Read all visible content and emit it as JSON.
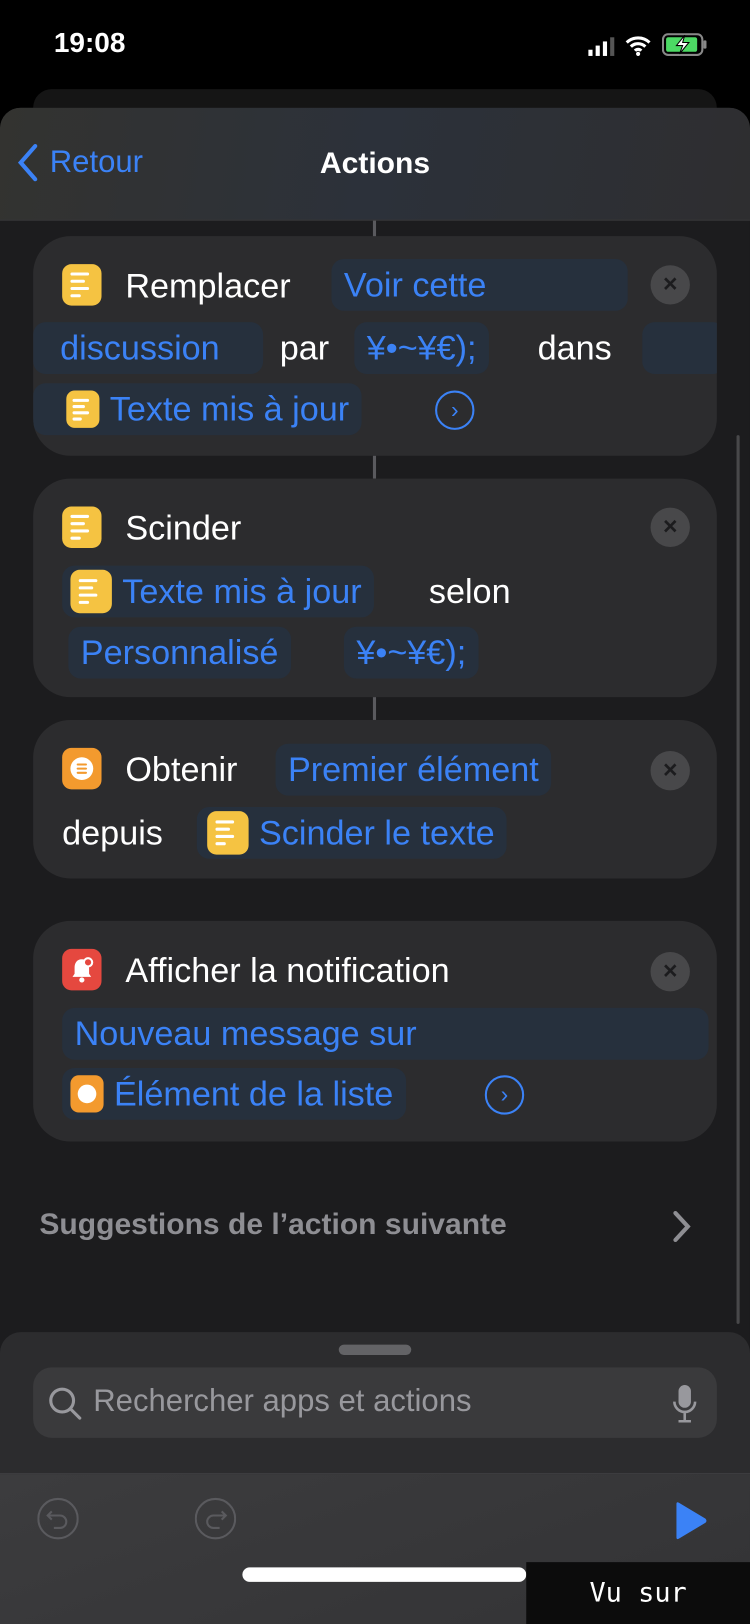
{
  "status_bar": {
    "time": "19:08",
    "signal": "cellular-icon",
    "wifi": "wifi-icon",
    "battery": "battery-charging-icon"
  },
  "nav": {
    "back_label": "Retour",
    "title": "Actions"
  },
  "actions": [
    {
      "verb": "Remplacer",
      "find_line1": "Voir cette",
      "find_line2": "discussion",
      "by": "par",
      "replacement": "¥•~¥€);",
      "in": "dans",
      "input": "Texte mis à jour"
    },
    {
      "verb": "Scinder",
      "input": "Texte mis à jour",
      "by": "selon",
      "separator_type": "Personnalisé",
      "separator": "¥•~¥€);"
    },
    {
      "verb": "Obtenir",
      "item": "Premier élément",
      "from": "depuis",
      "input": "Scinder le texte"
    },
    {
      "verb": "Afficher la notification",
      "body": "Nouveau message sur",
      "variable": "Élément de la liste"
    }
  ],
  "suggestions_label": "Suggestions de l’action suivante",
  "search": {
    "placeholder": "Rechercher apps et actions"
  },
  "watermark": "Vu sur Foforum",
  "colors": {
    "accent": "#3b82f6",
    "text_icon": "#f5c342",
    "list_icon": "#f39a2e",
    "notification_icon": "#e5483f",
    "background": "#1c1c1e",
    "card": "#2c2c2e"
  }
}
